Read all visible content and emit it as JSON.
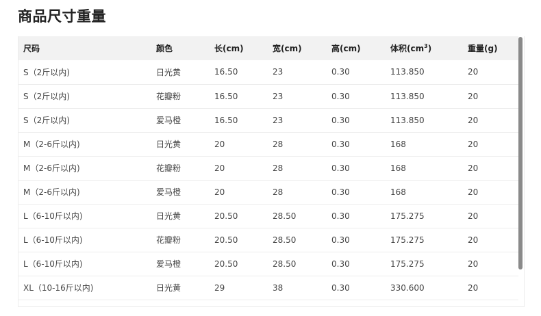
{
  "page": {
    "title": "商品尺寸重量"
  },
  "table": {
    "headers": [
      "尺码",
      "颜色",
      "长(cm)",
      "宽(cm)",
      "高(cm)",
      "体积(cm",
      "重量(g)"
    ],
    "volume_sup": "3",
    "volume_close": ")",
    "rows": [
      [
        "S（2斤以内)",
        "日光黄",
        "16.50",
        "23",
        "0.30",
        "113.850",
        "20"
      ],
      [
        "S（2斤以内)",
        "花瓣粉",
        "16.50",
        "23",
        "0.30",
        "113.850",
        "20"
      ],
      [
        "S（2斤以内)",
        "爱马橙",
        "16.50",
        "23",
        "0.30",
        "113.850",
        "20"
      ],
      [
        "M（2-6斤以内)",
        "日光黄",
        "20",
        "28",
        "0.30",
        "168",
        "20"
      ],
      [
        "M（2-6斤以内)",
        "花瓣粉",
        "20",
        "28",
        "0.30",
        "168",
        "20"
      ],
      [
        "M（2-6斤以内)",
        "爱马橙",
        "20",
        "28",
        "0.30",
        "168",
        "20"
      ],
      [
        "L（6-10斤以内)",
        "日光黄",
        "20.50",
        "28.50",
        "0.30",
        "175.275",
        "20"
      ],
      [
        "L（6-10斤以内)",
        "花瓣粉",
        "20.50",
        "28.50",
        "0.30",
        "175.275",
        "20"
      ],
      [
        "L（6-10斤以内)",
        "爱马橙",
        "20.50",
        "28.50",
        "0.30",
        "175.275",
        "20"
      ],
      [
        "XL（10-16斤以内)",
        "日光黄",
        "29",
        "38",
        "0.30",
        "330.600",
        "20"
      ]
    ]
  }
}
